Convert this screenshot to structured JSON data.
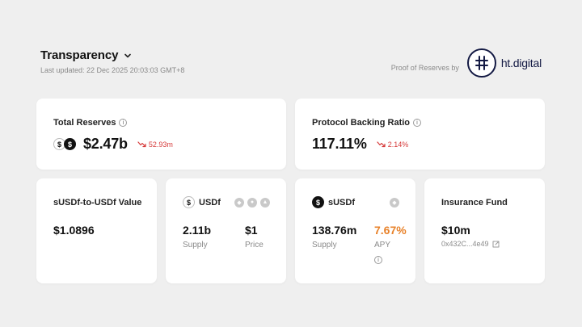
{
  "header": {
    "title": "Transparency",
    "last_updated": "Last updated: 22 Dec 2025 20:03:03 GMT+8",
    "proof_label": "Proof of Reserves by",
    "brand": "ht.digital"
  },
  "total_reserves": {
    "label": "Total Reserves",
    "value": "$2.47b",
    "change": "52.93m"
  },
  "backing_ratio": {
    "label": "Protocol Backing Ratio",
    "value": "117.11%",
    "change": "2.14%"
  },
  "susdf_value": {
    "label": "sUSDf-to-USDf Value",
    "value": "$1.0896"
  },
  "usdf": {
    "name": "USDf",
    "supply_value": "2.11b",
    "supply_label": "Supply",
    "price_value": "$1",
    "price_label": "Price"
  },
  "susdf": {
    "name": "sUSDf",
    "supply_value": "138.76m",
    "supply_label": "Supply",
    "apy_value": "7.67%",
    "apy_label": "APY"
  },
  "insurance": {
    "label": "Insurance Fund",
    "value": "$10m",
    "address": "0x432C...4e49"
  },
  "colors": {
    "background": "#efefef",
    "negative": "#d63a3a",
    "apy": "#e8822a",
    "brand": "#141a44"
  }
}
